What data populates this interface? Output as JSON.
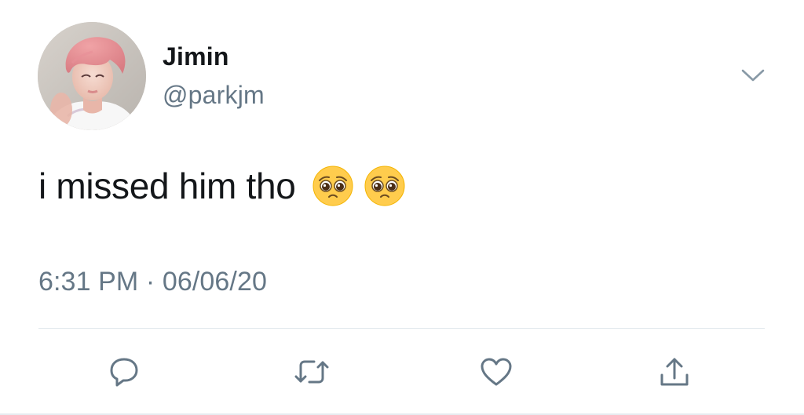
{
  "tweet": {
    "author": {
      "display_name": "Jimin",
      "handle": "@parkjm",
      "avatar_icon": "profile-photo"
    },
    "text": "i missed him tho",
    "emojis": [
      "pleading-face-emoji",
      "pleading-face-emoji"
    ],
    "timestamp": "6:31 PM · 06/06/20",
    "actions": [
      "reply-icon",
      "retweet-icon",
      "like-icon",
      "share-icon"
    ],
    "menu_icon": "chevron-down-icon"
  },
  "colors": {
    "text_primary": "#14171a",
    "text_secondary": "#657786",
    "icon": "#657786",
    "divider": "#e1e8ed"
  }
}
